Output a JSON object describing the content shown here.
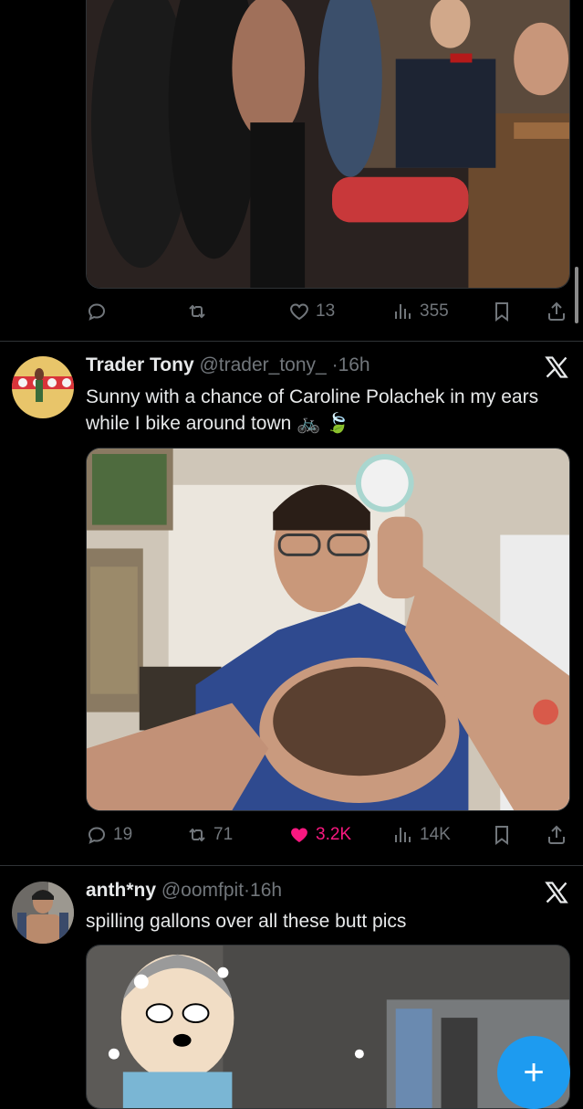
{
  "tweet1": {
    "actions": {
      "replies": "",
      "reposts": "",
      "likes": "13",
      "views": "355"
    }
  },
  "tweet2": {
    "name": "Trader Tony",
    "handle": "@trader_tony_",
    "time": "16h",
    "text": "Sunny with a chance of Caroline Polachek in my ears while I bike around town 🚲 🍃",
    "actions": {
      "replies": "19",
      "reposts": "71",
      "likes": "3.2K",
      "views": "14K"
    }
  },
  "tweet3": {
    "name": "anth*ny",
    "handle": "@oomfpit",
    "time": "16h",
    "text": "spilling gallons over all these butt pics"
  },
  "fab": {
    "label": "+"
  },
  "colors": {
    "accent": "#1d9bf0",
    "like": "#f91880",
    "muted": "#71767b",
    "bg": "#000000"
  }
}
